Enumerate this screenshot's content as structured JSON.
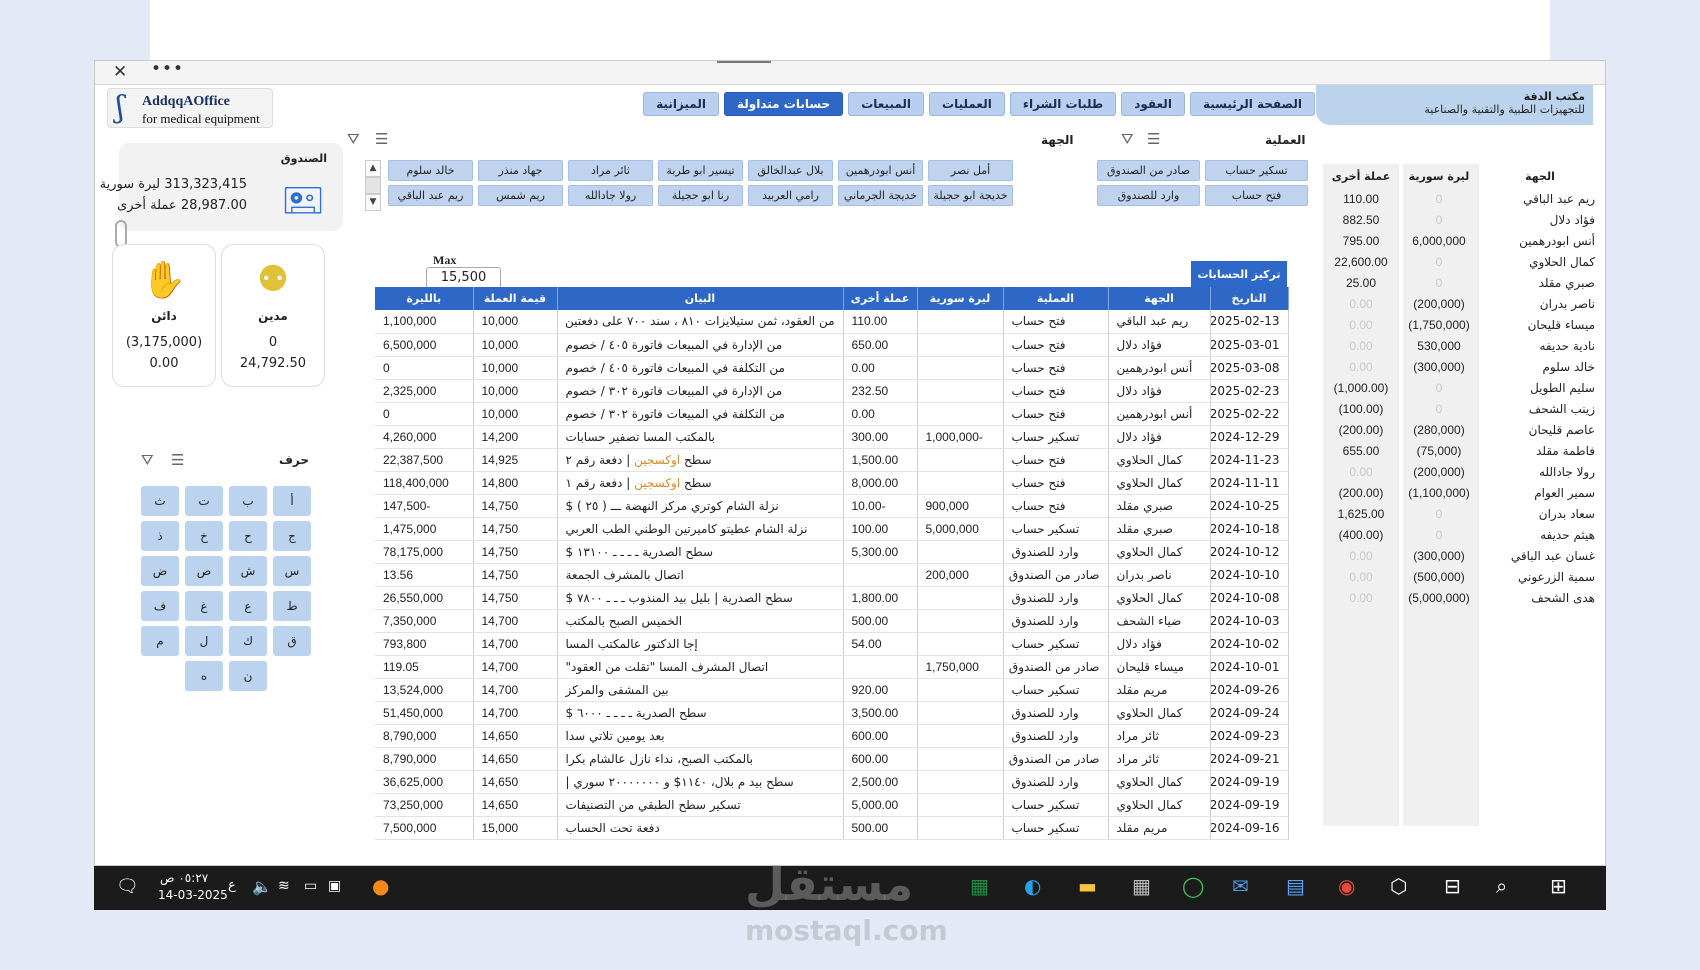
{
  "brand": {
    "logo_line1": "AddqqAOffice",
    "logo_line2": "for medical equipment",
    "office_name": "مكتب الدقة",
    "office_sub": "للتجهيزات الطبية والتقنية والصناعية"
  },
  "tabs": [
    {
      "label": "الصفحة الرئيسية",
      "active": false
    },
    {
      "label": "العقود",
      "active": false
    },
    {
      "label": "طلبات الشراء",
      "active": false
    },
    {
      "label": "العمليات",
      "active": false
    },
    {
      "label": "المبيعات",
      "active": false
    },
    {
      "label": "حسابات متداولة",
      "active": true
    },
    {
      "label": "الميزانية",
      "active": false
    }
  ],
  "fund": {
    "title": "الصندوق",
    "syp_line": "313,323,415 ليرة سورية",
    "other_line": "28,987.00 عملة أخرى"
  },
  "debtor": {
    "label": "مدين",
    "v1": "0",
    "v2": "24,792.50"
  },
  "creditor": {
    "label": "دائن",
    "v1": "(3,175,000)",
    "v2": "0.00"
  },
  "letters": {
    "title": "حرف",
    "keys": [
      "أ",
      "ب",
      "ت",
      "ث",
      "ج",
      "ح",
      "خ",
      "ذ",
      "س",
      "ش",
      "ص",
      "ض",
      "ط",
      "ع",
      "غ",
      "ف",
      "ق",
      "ك",
      "ل",
      "م",
      "ن",
      "ه"
    ]
  },
  "filters": {
    "operation_title": "العملية",
    "operations": [
      "تسكير حساب",
      "صادر من الصندوق",
      "فتح حساب",
      "وارد للصندوق"
    ],
    "party_title": "الجهة",
    "parties": [
      "أمل نصر",
      "أنس ابودرهمين",
      "بلال عبدالخالق",
      "تيسير ابو طربة",
      "ثائر مراد",
      "جهاد منذر",
      "خالد سلوم",
      "خديجة ابو حجيلة",
      "خديجة الجرماني",
      "رامي العربيد",
      "رنا ابو حجيلة",
      "رولا جادالله",
      "ريم شمس",
      "ريم عبد الباقي"
    ]
  },
  "max": {
    "label": "Max",
    "value": "15,500"
  },
  "rollup_button": "تركيز الحسابات",
  "ledger": {
    "headers": {
      "date": "التاريخ",
      "party": "الجهة",
      "op": "العملية",
      "syp": "ليرة سورية",
      "other": "عملة أخرى",
      "stmt": "البيان",
      "rate": "قيمة العملة",
      "inlira": "بالليرة"
    },
    "rows": [
      {
        "date": "2025-02-13",
        "party": "ريم عبد الباقي",
        "op": "فتح حساب",
        "syp": "",
        "other": "110.00",
        "stmt": "من العقود، ثمن ستيلايزات ٨١٠ ، سند ٧٠٠ على دفعتين",
        "rate": "10,000",
        "inlira": "1,100,000"
      },
      {
        "date": "2025-03-01",
        "party": "فؤاد دلال",
        "op": "فتح حساب",
        "syp": "",
        "other": "650.00",
        "stmt": "من الإدارة في المبيعات فاتورة ٤٠٥ / خصوم",
        "rate": "10,000",
        "inlira": "6,500,000"
      },
      {
        "date": "2025-03-08",
        "party": "أنس ابودرهمين",
        "op": "فتح حساب",
        "syp": "",
        "other": "0.00",
        "stmt": "من التكلفة في المبيعات فاتورة ٤٠٥ / خصوم",
        "rate": "10,000",
        "inlira": "0"
      },
      {
        "date": "2025-02-23",
        "party": "فؤاد دلال",
        "op": "فتح حساب",
        "syp": "",
        "other": "232.50",
        "stmt": "من الإدارة في المبيعات فاتورة ٣٠٢ / خصوم",
        "rate": "10,000",
        "inlira": "2,325,000"
      },
      {
        "date": "2025-02-22",
        "party": "أنس ابودرهمين",
        "op": "فتح حساب",
        "syp": "",
        "other": "0.00",
        "stmt": "من التكلفة في المبيعات فاتورة ٣٠٢ / خصوم",
        "rate": "10,000",
        "inlira": "0"
      },
      {
        "date": "2024-12-29",
        "party": "فؤاد دلال",
        "op": "تسكير حساب",
        "syp": "-1,000,000",
        "other": "300.00",
        "stmt": "بالمكتب المسا تصفير حسابات",
        "rate": "14,200",
        "inlira": "4,260,000"
      },
      {
        "date": "2024-11-23",
        "party": "كمال الحلاوي",
        "op": "فتح حساب",
        "syp": "",
        "other": "1,500.00",
        "stmt": "سطح اوكسجين | دفعة رقم ٢",
        "rate": "14,925",
        "inlira": "22,387,500"
      },
      {
        "date": "2024-11-11",
        "party": "كمال الحلاوي",
        "op": "فتح حساب",
        "syp": "",
        "other": "8,000.00",
        "stmt": "سطح اوكسجين | دفعة رقم ١",
        "rate": "14,800",
        "inlira": "118,400,000"
      },
      {
        "date": "2024-10-25",
        "party": "صبري مقلد",
        "op": "فتح حساب",
        "syp": "900,000",
        "other": "-10.00",
        "stmt": "نزلة الشام كوتري مركز النهضة ـــ ( ٢٥ ) $",
        "rate": "14,750",
        "inlira": "-147,500"
      },
      {
        "date": "2024-10-18",
        "party": "صبري مقلد",
        "op": "تسكير حساب",
        "syp": "5,000,000",
        "other": "100.00",
        "stmt": "نزلة الشام عطيتو كاميرتين الوطني الطب العربي",
        "rate": "14,750",
        "inlira": "1,475,000"
      },
      {
        "date": "2024-10-12",
        "party": "كمال الحلاوي",
        "op": "وارد للصندوق",
        "syp": "",
        "other": "5,300.00",
        "stmt": "سطح الصدرية ـ ـ ـ ـ ١٣١٠٠ $",
        "rate": "14,750",
        "inlira": "78,175,000"
      },
      {
        "date": "2024-10-10",
        "party": "ناصر بدران",
        "op": "صادر من الصندوق",
        "syp": "200,000",
        "other": "",
        "stmt": "اتصال بالمشرف الجمعة",
        "rate": "14,750",
        "inlira": "13.56"
      },
      {
        "date": "2024-10-08",
        "party": "كمال الحلاوي",
        "op": "وارد للصندوق",
        "syp": "",
        "other": "1,800.00",
        "stmt": "سطح الصدرية | بليل بيد المندوب ـ ـ ـ ٧٨٠٠ $",
        "rate": "14,750",
        "inlira": "26,550,000"
      },
      {
        "date": "2024-10-03",
        "party": "ضياء الشحف",
        "op": "وارد للصندوق",
        "syp": "",
        "other": "500.00",
        "stmt": "الخميس الصبح بالمكتب",
        "rate": "14,700",
        "inlira": "7,350,000"
      },
      {
        "date": "2024-10-02",
        "party": "فؤاد دلال",
        "op": "تسكير حساب",
        "syp": "",
        "other": "54.00",
        "stmt": "إجا الدكتور عالمكتب المسا",
        "rate": "14,700",
        "inlira": "793,800"
      },
      {
        "date": "2024-10-01",
        "party": "ميساء قليحان",
        "op": "صادر من الصندوق",
        "syp": "1,750,000",
        "other": "",
        "stmt": "اتصال المشرف المسا \"تقلت من العقود\"",
        "rate": "14,700",
        "inlira": "119.05"
      },
      {
        "date": "2024-09-26",
        "party": "مريم مقلد",
        "op": "تسكير حساب",
        "syp": "",
        "other": "920.00",
        "stmt": "بين المشفى والمركز",
        "rate": "14,700",
        "inlira": "13,524,000"
      },
      {
        "date": "2024-09-24",
        "party": "كمال الحلاوي",
        "op": "وارد للصندوق",
        "syp": "",
        "other": "3,500.00",
        "stmt": "سطح الصدرية ـ ـ ـ ـ ٦٠٠٠ $",
        "rate": "14,700",
        "inlira": "51,450,000"
      },
      {
        "date": "2024-09-23",
        "party": "ثائر مراد",
        "op": "وارد للصندوق",
        "syp": "",
        "other": "600.00",
        "stmt": "بعد يومين تلاتي سدا",
        "rate": "14,650",
        "inlira": "8,790,000"
      },
      {
        "date": "2024-09-21",
        "party": "ثائر مراد",
        "op": "صادر من الصندوق",
        "syp": "",
        "other": "600.00",
        "stmt": "بالمكتب الصبح، نداء نازل عالشام بكرا",
        "rate": "14,650",
        "inlira": "8,790,000"
      },
      {
        "date": "2024-09-19",
        "party": "كمال الحلاوي",
        "op": "وارد للصندوق",
        "syp": "",
        "other": "2,500.00",
        "stmt": "سطح بيد م بلال، ١١٤٠$ و ٢٠٠٠٠٠٠٠ سوري |",
        "rate": "14,650",
        "inlira": "36,625,000"
      },
      {
        "date": "2024-09-19",
        "party": "كمال الحلاوي",
        "op": "تسكير حساب",
        "syp": "",
        "other": "5,000.00",
        "stmt": "تسكير سطح الطبقي من التصنيفات",
        "rate": "14,650",
        "inlira": "73,250,000"
      },
      {
        "date": "2024-09-16",
        "party": "مريم مقلد",
        "op": "تسكير حساب",
        "syp": "",
        "other": "500.00",
        "stmt": "دفعة تحت الحساب",
        "rate": "15,000",
        "inlira": "7,500,000"
      }
    ]
  },
  "summary": {
    "headers": {
      "name": "الجهة",
      "syp": "ليرة سورية",
      "other": "عملة أخرى"
    },
    "rows": [
      {
        "name": "ريم عبد الباقي",
        "syp": "0",
        "other": "110.00"
      },
      {
        "name": "فؤاد دلال",
        "syp": "0",
        "other": "882.50"
      },
      {
        "name": "أنس ابودرهمين",
        "syp": "6,000,000",
        "other": "795.00"
      },
      {
        "name": "كمال الحلاوي",
        "syp": "0",
        "other": "22,600.00"
      },
      {
        "name": "صبري مقلد",
        "syp": "0",
        "other": "25.00"
      },
      {
        "name": "ناصر بدران",
        "syp": "(200,000)",
        "other": "0.00"
      },
      {
        "name": "ميساء قليحان",
        "syp": "(1,750,000)",
        "other": "0.00"
      },
      {
        "name": "نادية حديفه",
        "syp": "530,000",
        "other": "0.00"
      },
      {
        "name": "خالد سلوم",
        "syp": "(300,000)",
        "other": "0.00"
      },
      {
        "name": "سليم الطويل",
        "syp": "0",
        "other": "(1,000.00)"
      },
      {
        "name": "زينب الشحف",
        "syp": "0",
        "other": "(100.00)"
      },
      {
        "name": "عاصم قليحان",
        "syp": "(280,000)",
        "other": "(200.00)"
      },
      {
        "name": "فاطمة مقلد",
        "syp": "(75,000)",
        "other": "655.00"
      },
      {
        "name": "رولا جادالله",
        "syp": "(200,000)",
        "other": "0.00"
      },
      {
        "name": "سمير العوام",
        "syp": "(1,100,000)",
        "other": "(200.00)"
      },
      {
        "name": "سعاد بدران",
        "syp": "0",
        "other": "1,625.00"
      },
      {
        "name": "هيثم حديفه",
        "syp": "0",
        "other": "(400.00)"
      },
      {
        "name": "غسان عبد الباقي",
        "syp": "(300,000)",
        "other": "0.00"
      },
      {
        "name": "سمية الزرعوني",
        "syp": "(500,000)",
        "other": "0.00"
      },
      {
        "name": "هدى الشحف",
        "syp": "(5,000,000)",
        "other": "0.00"
      }
    ]
  },
  "taskbar": {
    "time": "٠٥:٢٧ ص",
    "date": "14-03-2025",
    "lang": "ع"
  },
  "watermark": {
    "arabic": "مستقل",
    "latin": "mostaql.com"
  },
  "colors": {
    "accent": "#2f67c7",
    "chip": "#bfd3ef",
    "bg": "#e3e9f6"
  }
}
